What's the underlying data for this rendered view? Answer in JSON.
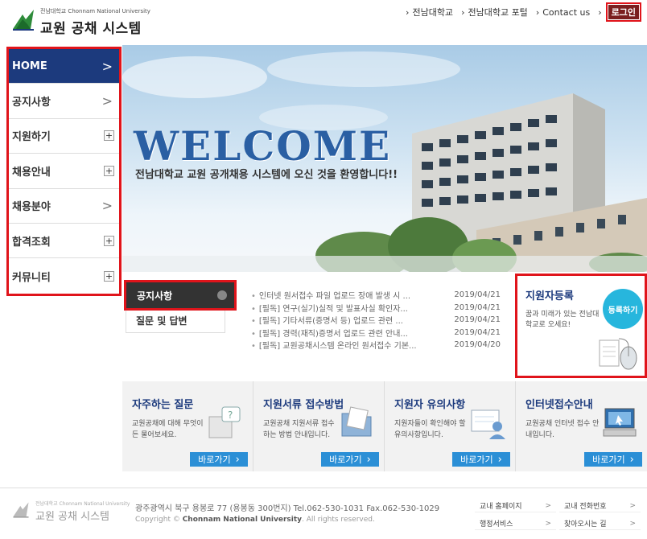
{
  "header": {
    "logo_small": "전남대학교 Chonnam National University",
    "logo_title": "교원 공채 시스템",
    "top_links": [
      "전남대학교",
      "전남대학교 포털",
      "Contact us"
    ],
    "login_label": "로그인"
  },
  "sidebar": {
    "items": [
      {
        "label": "HOME",
        "control": "arrow"
      },
      {
        "label": "공지사항",
        "control": "arrow"
      },
      {
        "label": "지원하기",
        "control": "plus"
      },
      {
        "label": "채용안내",
        "control": "plus"
      },
      {
        "label": "채용분야",
        "control": "arrow"
      },
      {
        "label": "합격조회",
        "control": "plus"
      },
      {
        "label": "커뮤니티",
        "control": "plus"
      }
    ],
    "arrow_glyph": ">",
    "plus_glyph": "+"
  },
  "hero": {
    "welcome": "WELCOME",
    "subtitle": "전남대학교 교원 공개채용 시스템에 오신 것을 환영합니다!!"
  },
  "notice": {
    "tab_notice": "공지사항",
    "tab_qna": "질문 및 답변",
    "rows": [
      {
        "title": "인터넷 원서접수 파일 업로드 장애 발생 시 ...",
        "date": "2019/04/21"
      },
      {
        "title": "[필독] 연구(실기)실적 및 발표사실 확인자...",
        "date": "2019/04/21"
      },
      {
        "title": "[필독] 기타서류(증명서 등) 업로드 관련 ...",
        "date": "2019/04/21"
      },
      {
        "title": "[필독] 경력(재직)증명서 업로드 관련 안내...",
        "date": "2019/04/21"
      },
      {
        "title": "[필독] 교원공채시스템 온라인 원서접수 기본...",
        "date": "2019/04/20"
      }
    ]
  },
  "register": {
    "title": "지원자등록",
    "desc": "꿈과 미래가 있는 전남대학교로 오세요!",
    "button": "등록하기"
  },
  "cards": [
    {
      "title": "자주하는 질문",
      "desc": "교원공채에 대해 무엇이든 물어보세요.",
      "button": "바로가기",
      "icon": "faq-icon"
    },
    {
      "title": "지원서류 접수방법",
      "desc": "교원공채 지원서류 접수하는 방법 안내입니다.",
      "button": "바로가기",
      "icon": "folder-icon"
    },
    {
      "title": "지원자 유의사항",
      "desc": "지원자들이 확인해야 할 유의사항입니다.",
      "button": "바로가기",
      "icon": "applicant-notice-icon"
    },
    {
      "title": "인터넷접수안내",
      "desc": "교원공채 인터넷 접수 안내입니다.",
      "button": "바로가기",
      "icon": "computer-icon"
    }
  ],
  "footer": {
    "logo_small": "전남대학교 Chonnam National University",
    "logo_title": "교원 공채 시스템",
    "address": "광주광역시 북구 용봉로 77 (용봉동 300번지) Tel.062-530-1031 Fax.062-530-1029",
    "copyright_prefix": "Copyright © ",
    "copyright_bold": "Chonnam National University",
    "copyright_suffix": ". All rights reserved.",
    "links": [
      "교내 홈페이지",
      "교내 전화번호",
      "행정서비스",
      "찾아오시는 길"
    ],
    "link_arrow": ">"
  },
  "colors": {
    "highlight": "#e0141b",
    "primary_navy": "#1c3a7d",
    "button_blue": "#2b8fd6",
    "register_cyan": "#27b6dd"
  }
}
